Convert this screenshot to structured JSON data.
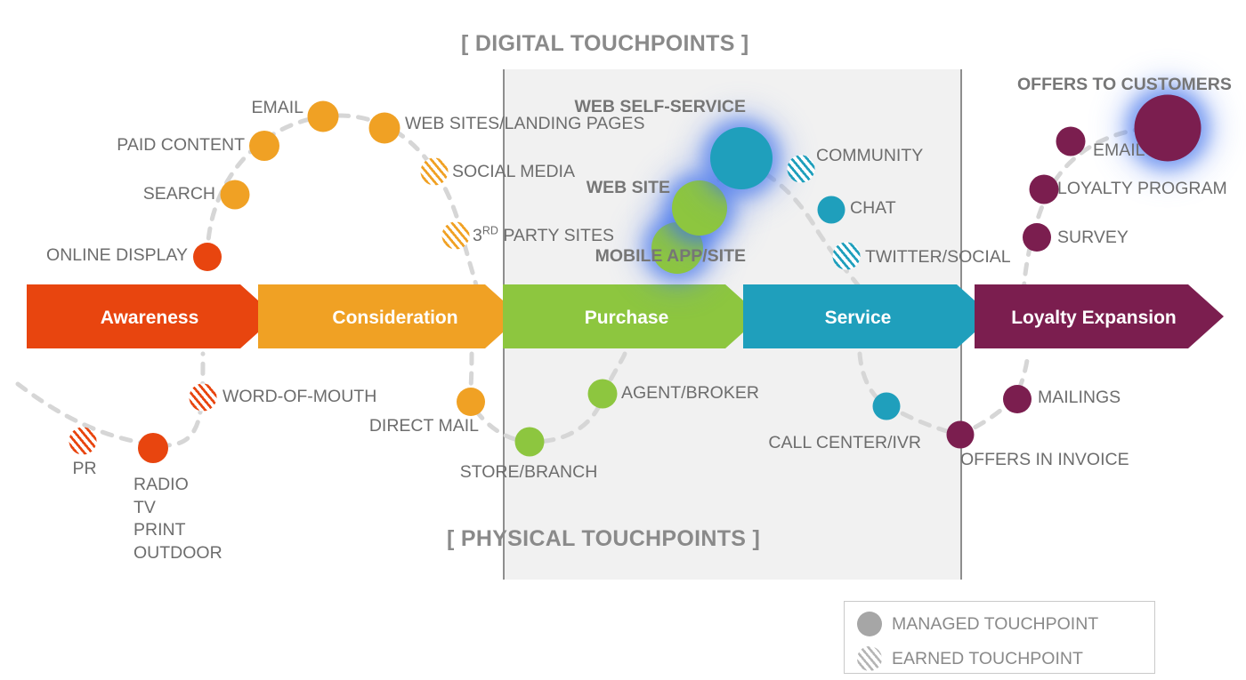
{
  "sections": {
    "digital_caption": "[ DIGITAL TOUCHPOINTS ]",
    "physical_caption": "[ PHYSICAL TOUCHPOINTS ]"
  },
  "stages": [
    {
      "label": "Awareness",
      "color": "#e8450f"
    },
    {
      "label": "Consideration",
      "color": "#f0a124"
    },
    {
      "label": "Purchase",
      "color": "#8dc63f"
    },
    {
      "label": "Service",
      "color": "#1f9fbc"
    },
    {
      "label": "Loyalty Expansion",
      "color": "#7b1e4f"
    }
  ],
  "legend": {
    "managed_label": "MANAGED TOUCHPOINT",
    "earned_label": "EARNED TOUCHPOINT",
    "managed_color": "#a6a6a6",
    "earned_color": "#b5b5b5"
  },
  "touchpoints": {
    "online_display": {
      "label": "ONLINE DISPLAY",
      "type": "managed",
      "color": "#e8450f",
      "stage": "Awareness",
      "track": "digital"
    },
    "search": {
      "label": "SEARCH",
      "type": "managed",
      "color": "#f0a124",
      "stage": "Awareness",
      "track": "digital"
    },
    "paid_content": {
      "label": "PAID CONTENT",
      "type": "managed",
      "color": "#f0a124",
      "stage": "Awareness",
      "track": "digital"
    },
    "email_aware": {
      "label": "EMAIL",
      "type": "managed",
      "color": "#f0a124",
      "stage": "Awareness",
      "track": "digital"
    },
    "web_sites": {
      "label": "WEB SITES/LANDING PAGES",
      "type": "managed",
      "color": "#f0a124",
      "stage": "Consideration",
      "track": "digital"
    },
    "social_media": {
      "label": "SOCIAL MEDIA",
      "type": "earned",
      "color": "#f0a124",
      "stage": "Consideration",
      "track": "digital"
    },
    "third_party": {
      "label": "PARTY SITES",
      "prefix": "3",
      "sup": "RD",
      "type": "earned",
      "color": "#f0a124",
      "stage": "Consideration",
      "track": "digital"
    },
    "mobile_app": {
      "label": "MOBILE APP/SITE",
      "type": "managed",
      "color": "#8dc63f",
      "stage": "Purchase",
      "track": "digital",
      "highlighted": true
    },
    "web_site": {
      "label": "WEB SITE",
      "type": "managed",
      "color": "#8dc63f",
      "stage": "Purchase",
      "track": "digital",
      "highlighted": true
    },
    "web_self_service": {
      "label": "WEB SELF-SERVICE",
      "type": "managed",
      "color": "#1f9fbc",
      "stage": "Service",
      "track": "digital",
      "highlighted": true
    },
    "community": {
      "label": "COMMUNITY",
      "type": "earned",
      "color": "#1f9fbc",
      "stage": "Service",
      "track": "digital"
    },
    "chat": {
      "label": "CHAT",
      "type": "managed",
      "color": "#1f9fbc",
      "stage": "Service",
      "track": "digital"
    },
    "twitter_social": {
      "label": "TWITTER/SOCIAL",
      "type": "earned",
      "color": "#1f9fbc",
      "stage": "Service",
      "track": "digital"
    },
    "survey": {
      "label": "SURVEY",
      "type": "managed",
      "color": "#7b1e4f",
      "stage": "Loyalty Expansion",
      "track": "digital"
    },
    "loyalty_program": {
      "label": "LOYALTY PROGRAM",
      "type": "managed",
      "color": "#7b1e4f",
      "stage": "Loyalty Expansion",
      "track": "digital"
    },
    "email_loyalty": {
      "label": "EMAIL",
      "type": "managed",
      "color": "#7b1e4f",
      "stage": "Loyalty Expansion",
      "track": "digital"
    },
    "offers_customers": {
      "label": "OFFERS TO CUSTOMERS",
      "type": "managed",
      "color": "#7b1e4f",
      "stage": "Loyalty Expansion",
      "track": "digital",
      "highlighted": true
    },
    "pr": {
      "label": "PR",
      "type": "earned",
      "color": "#e8450f",
      "stage": "Awareness",
      "track": "physical"
    },
    "radio_tv": {
      "label": "RADIO\nTV\nPRINT\nOUTDOOR",
      "type": "managed",
      "color": "#e8450f",
      "stage": "Awareness",
      "track": "physical"
    },
    "word_of_mouth": {
      "label": "WORD-OF-MOUTH",
      "type": "earned",
      "color": "#e8450f",
      "stage": "Awareness",
      "track": "physical"
    },
    "direct_mail": {
      "label": "DIRECT MAIL",
      "type": "managed",
      "color": "#f0a124",
      "stage": "Consideration",
      "track": "physical"
    },
    "store_branch": {
      "label": "STORE/BRANCH",
      "type": "managed",
      "color": "#8dc63f",
      "stage": "Purchase",
      "track": "physical"
    },
    "agent_broker": {
      "label": "AGENT/BROKER",
      "type": "managed",
      "color": "#8dc63f",
      "stage": "Purchase",
      "track": "physical"
    },
    "call_center": {
      "label": "CALL CENTER/IVR",
      "type": "managed",
      "color": "#1f9fbc",
      "stage": "Service",
      "track": "physical"
    },
    "offers_invoice": {
      "label": "OFFERS IN INVOICE",
      "type": "managed",
      "color": "#7b1e4f",
      "stage": "Loyalty Expansion",
      "track": "physical"
    },
    "mailings": {
      "label": "MAILINGS",
      "type": "managed",
      "color": "#7b1e4f",
      "stage": "Loyalty Expansion",
      "track": "physical"
    }
  },
  "radio_lines": [
    "RADIO",
    "TV",
    "PRINT",
    "OUTDOOR"
  ],
  "colors": {
    "awareness": "#e8450f",
    "consideration": "#f0a124",
    "purchase": "#8dc63f",
    "service": "#1f9fbc",
    "loyalty": "#7b1e4f",
    "glow": "#3a6eeb",
    "band": "#f1f1f1",
    "text_gray": "#6d6d6d",
    "dash": "#d6d6d6"
  }
}
